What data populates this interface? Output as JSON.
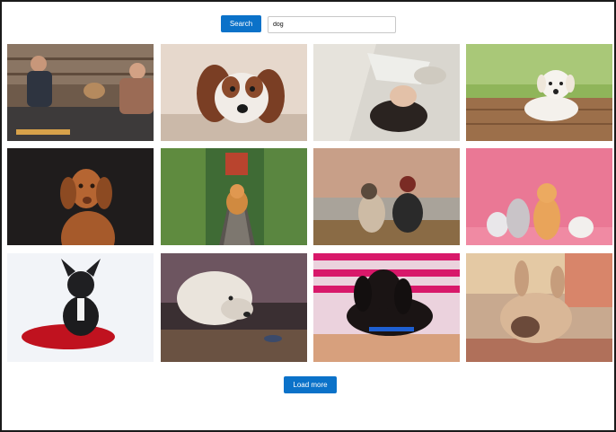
{
  "search": {
    "button_label": "Search",
    "query": "dog"
  },
  "gallery": {
    "photos": [
      {
        "subject": "two-people-with-dog-on-bench"
      },
      {
        "subject": "spaniel-puppy-lying"
      },
      {
        "subject": "woman-lying-on-blanket"
      },
      {
        "subject": "white-puppy-on-deck"
      },
      {
        "subject": "vizsla-portrait"
      },
      {
        "subject": "corgi-on-railway-track"
      },
      {
        "subject": "person-and-dog-by-lake"
      },
      {
        "subject": "dogs-and-cat-on-pink"
      },
      {
        "subject": "french-bulldog-on-red-pillow"
      },
      {
        "subject": "white-dog-surreal-scene"
      },
      {
        "subject": "dachshund-puppy-in-lap"
      },
      {
        "subject": "french-bulldog-resting"
      }
    ]
  },
  "pagination": {
    "load_more_label": "Load more"
  }
}
